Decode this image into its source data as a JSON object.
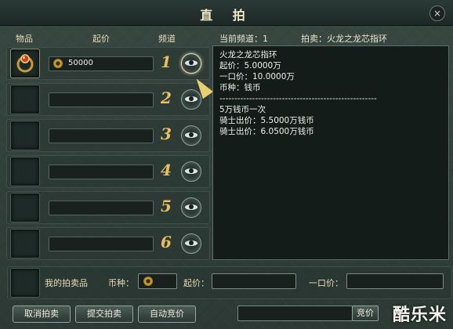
{
  "window": {
    "title": "直 拍",
    "close_label": "×"
  },
  "left": {
    "headers": {
      "item": "物品",
      "price": "起价",
      "channel": "频道"
    },
    "slots": [
      {
        "channel": "1",
        "price": "50000",
        "has_item": true
      },
      {
        "channel": "2",
        "price": "",
        "has_item": false
      },
      {
        "channel": "3",
        "price": "",
        "has_item": false
      },
      {
        "channel": "4",
        "price": "",
        "has_item": false
      },
      {
        "channel": "5",
        "price": "",
        "has_item": false
      },
      {
        "channel": "6",
        "price": "",
        "has_item": false
      }
    ]
  },
  "right": {
    "current_channel": "当前频道：1",
    "auction_label": "拍卖：火龙之龙芯指环",
    "info_lines": [
      "火龙之龙芯指环",
      "起价：5.0000万",
      "一口价：10.0000万",
      "币种：钱币",
      "-----------------------------------------------------",
      "5万钱币一次",
      "骑士出价：5.5000万钱币",
      "骑士出价：6.0500万钱币"
    ]
  },
  "bottom": {
    "my_item_label": "我的拍卖品",
    "currency_label": "币种：",
    "start_price_label": "起价：",
    "buyout_label": "一口价："
  },
  "buttons": {
    "cancel": "取消拍卖",
    "submit": "提交拍卖",
    "auto_bid": "自动竞价",
    "bid": "竞价"
  },
  "watermark": "酷乐米",
  "icons": {
    "close": "close-icon",
    "eye": "eye-icon",
    "coin": "coin-icon",
    "cursor": "mouse-cursor-icon"
  },
  "colors": {
    "accent": "#e8c060",
    "panel": "#141c1a"
  }
}
